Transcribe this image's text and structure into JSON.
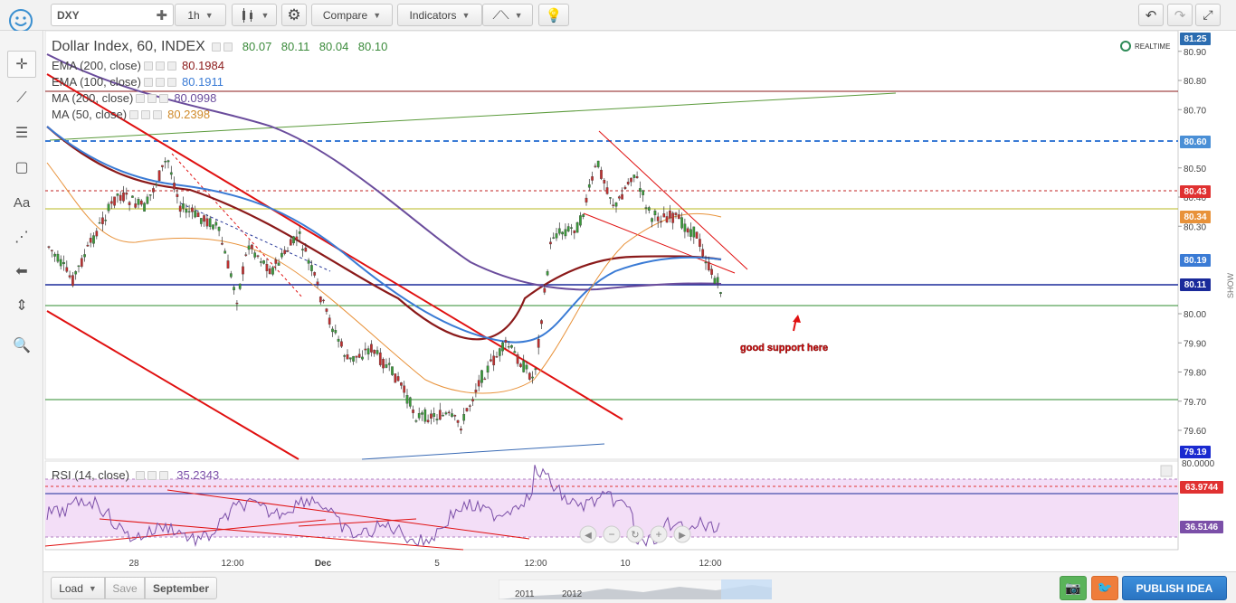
{
  "toolbar": {
    "symbol": "DXY",
    "interval": "1h",
    "compare_label": "Compare",
    "indicators_label": "Indicators"
  },
  "chart": {
    "title": "Dollar Index, 60, INDEX",
    "ohlc": [
      "80.07",
      "80.11",
      "80.04",
      "80.10"
    ],
    "realtime_label": "REALTIME",
    "indicators": [
      {
        "label": "EMA (200, close)",
        "value": "80.1984",
        "color": "#8b1a1a"
      },
      {
        "label": "EMA (100, close)",
        "value": "80.1911",
        "color": "#3a7bd5"
      },
      {
        "label": "MA (200, close)",
        "value": "80.0998",
        "color": "#6a4c9c"
      },
      {
        "label": "MA (50, close)",
        "value": "80.2398",
        "color": "#d08a2a"
      }
    ],
    "price_axis": [
      "80.90",
      "80.80",
      "80.70",
      "80.50",
      "80.40",
      "80.30",
      "80.00",
      "79.90",
      "79.80",
      "79.70",
      "79.60"
    ],
    "price_tags": [
      {
        "label": "81.25",
        "color": "#2b6cb0"
      },
      {
        "label": "80.60",
        "color": "#4a8fd6"
      },
      {
        "label": "80.43",
        "color": "#e03131"
      },
      {
        "label": "80.34",
        "color": "#e8923a"
      },
      {
        "label": "80.19",
        "color": "#3a7bd5"
      },
      {
        "label": "80.11",
        "color": "#1a2a9a"
      },
      {
        "label": "79.19",
        "color": "#1a2ad0"
      }
    ],
    "annotation": "good support here",
    "show_label": "SHOW",
    "time_axis": [
      "28",
      "12:00",
      "Dec",
      "5",
      "12:00",
      "10",
      "12:00"
    ]
  },
  "rsi": {
    "label": "RSI (14, close)",
    "value": "35.2343",
    "axis_top": "80.0000",
    "tags": [
      {
        "label": "63.9744",
        "color": "#e03131"
      },
      {
        "label": "36.5146",
        "color": "#7b4fa8"
      }
    ]
  },
  "bottom": {
    "load_label": "Load",
    "save_label": "Save",
    "tab_label": "September",
    "years": [
      "2011",
      "2012"
    ],
    "publish_label": "PUBLISH IDEA"
  }
}
